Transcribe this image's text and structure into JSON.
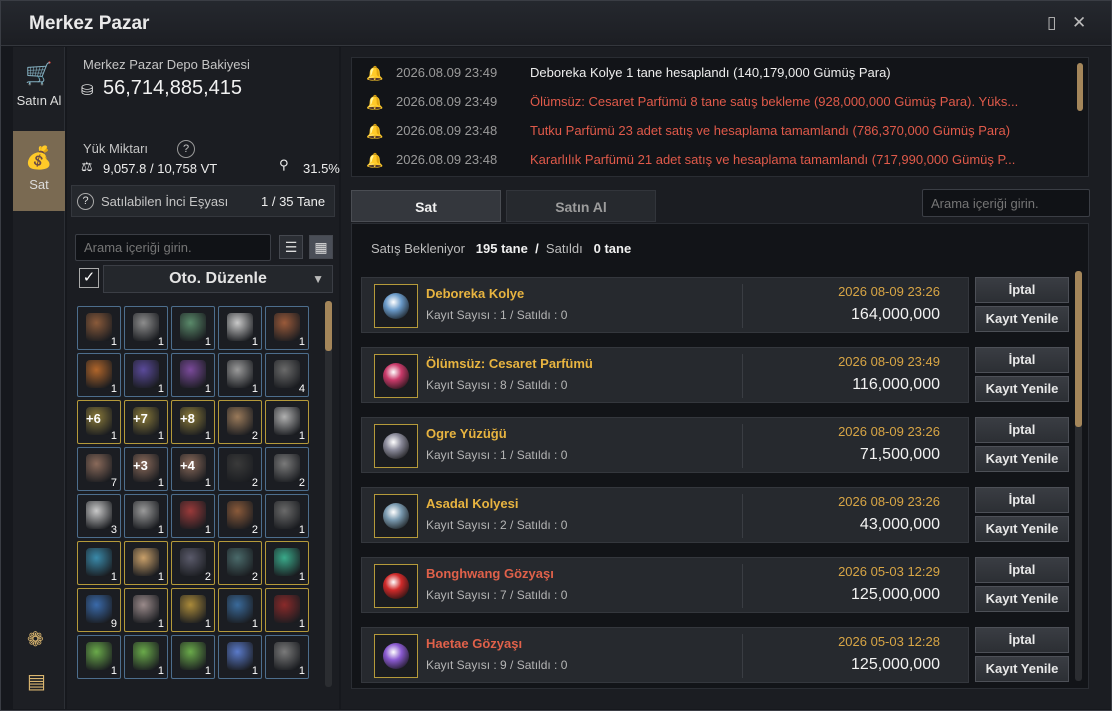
{
  "window": {
    "title": "Merkez Pazar"
  },
  "nav": {
    "buy_label": "Satın Al",
    "sell_label": "Sat"
  },
  "wallet": {
    "label": "Merkez Pazar Depo Bakiyesi",
    "value": "56,714,885,415"
  },
  "weight": {
    "label": "Yük Miktarı",
    "value": "9,057.8 / 10,758 VT",
    "percent": "31.5%"
  },
  "pearl": {
    "label": "Satılabilen İnci Eşyası",
    "value": "1 / 35 Tane"
  },
  "left_search": {
    "placeholder": "Arama içeriği girin."
  },
  "auto_sort": {
    "label": "Oto. Düzenle"
  },
  "inventory": [
    {
      "color": "#8a5a3a",
      "count": "1",
      "enh": ""
    },
    {
      "color": "#8d8d8d",
      "count": "1",
      "enh": ""
    },
    {
      "color": "#5a8a6a",
      "count": "1",
      "enh": ""
    },
    {
      "color": "#c9c9c9",
      "count": "1",
      "enh": ""
    },
    {
      "color": "#9a5a3a",
      "count": "1",
      "enh": ""
    },
    {
      "color": "#b0652a",
      "count": "1",
      "enh": ""
    },
    {
      "color": "#5a4a9a",
      "count": "1",
      "enh": ""
    },
    {
      "color": "#7a4a9a",
      "count": "1",
      "enh": ""
    },
    {
      "color": "#9a9a9a",
      "count": "1",
      "enh": ""
    },
    {
      "color": "#6a6a6a",
      "count": "4",
      "enh": ""
    },
    {
      "color": "#8a7a3a",
      "count": "1",
      "enh": "+6"
    },
    {
      "color": "#8a7a3a",
      "count": "1",
      "enh": "+7"
    },
    {
      "color": "#8a7a3a",
      "count": "1",
      "enh": "+8"
    },
    {
      "color": "#9a7a5a",
      "count": "2",
      "enh": ""
    },
    {
      "color": "#b0b0b0",
      "count": "1",
      "enh": ""
    },
    {
      "color": "#8a6a5a",
      "count": "7",
      "enh": ""
    },
    {
      "color": "#8a6a5a",
      "count": "1",
      "enh": "+3"
    },
    {
      "color": "#8a6a5a",
      "count": "1",
      "enh": "+4"
    },
    {
      "color": "#3a3a3a",
      "count": "2",
      "enh": ""
    },
    {
      "color": "#7a7a7a",
      "count": "2",
      "enh": ""
    },
    {
      "color": "#c9c9c9",
      "count": "3",
      "enh": ""
    },
    {
      "color": "#9a9a9a",
      "count": "1",
      "enh": ""
    },
    {
      "color": "#9a3a3a",
      "count": "1",
      "enh": ""
    },
    {
      "color": "#8a5a3a",
      "count": "2",
      "enh": ""
    },
    {
      "color": "#6a6a6a",
      "count": "1",
      "enh": ""
    },
    {
      "color": "#3a8aaa",
      "count": "1",
      "enh": ""
    },
    {
      "color": "#c9a06a",
      "count": "1",
      "enh": ""
    },
    {
      "color": "#5a5a6a",
      "count": "2",
      "enh": ""
    },
    {
      "color": "#4a6a6a",
      "count": "2",
      "enh": ""
    },
    {
      "color": "#3aaa8a",
      "count": "1",
      "enh": ""
    },
    {
      "color": "#3a6aaa",
      "count": "9",
      "enh": ""
    },
    {
      "color": "#9a8a8a",
      "count": "1",
      "enh": ""
    },
    {
      "color": "#aa8a3a",
      "count": "1",
      "enh": ""
    },
    {
      "color": "#3a6a9a",
      "count": "1",
      "enh": ""
    },
    {
      "color": "#8a2a2a",
      "count": "1",
      "enh": ""
    },
    {
      "color": "#6aaa4a",
      "count": "1",
      "enh": ""
    },
    {
      "color": "#6aaa4a",
      "count": "1",
      "enh": ""
    },
    {
      "color": "#6aaa4a",
      "count": "1",
      "enh": ""
    },
    {
      "color": "#5a7ac9",
      "count": "1",
      "enh": ""
    },
    {
      "color": "#7a7a7a",
      "count": "1",
      "enh": ""
    }
  ],
  "log": [
    {
      "time": "2026.08.09 23:49",
      "text": "Deboreka Kolye 1 tane hesaplandı (140,179,000 Gümüş Para)",
      "color": "#eeeeee"
    },
    {
      "time": "2026.08.09 23:49",
      "text": "Ölümsüz: Cesaret Parfümü 8 tane satış bekleme (928,000,000 Gümüş Para). Yüks...",
      "color": "#e05a4a"
    },
    {
      "time": "2026.08.09 23:48",
      "text": "Tutku Parfümü 23 adet satış ve hesaplama tamamlandı (786,370,000 Gümüş Para)",
      "color": "#e05a4a"
    },
    {
      "time": "2026.08.09 23:48",
      "text": "Kararlılık Parfümü 21 adet satış ve hesaplama tamamlandı (717,990,000 Gümüş P...",
      "color": "#e05a4a"
    }
  ],
  "tabs": {
    "sell": "Sat",
    "buy": "Satın Al"
  },
  "right_search": {
    "placeholder": "Arama içeriği girin."
  },
  "status": {
    "waiting_label": "Satış Bekleniyor",
    "waiting_value": "195 tane",
    "sep": "/",
    "sold_label": "Satıldı",
    "sold_value": "0 tane"
  },
  "listings": [
    {
      "name": "Deboreka Kolye",
      "name_color": "#e8b440",
      "sub": "Kayıt Sayısı : 1 / Satıldı : 0",
      "date": "2026 08-09 23:26",
      "price": "164,000,000",
      "icon": "#6a9ac9"
    },
    {
      "name": "Ölümsüz: Cesaret Parfümü",
      "name_color": "#e8b440",
      "sub": "Kayıt Sayısı : 8 / Satıldı : 0",
      "date": "2026 08-09 23:49",
      "price": "116,000,000",
      "icon": "#c93a6a"
    },
    {
      "name": "Ogre Yüzüğü",
      "name_color": "#e8b440",
      "sub": "Kayıt Sayısı : 1 / Satıldı : 0",
      "date": "2026 08-09 23:26",
      "price": "71,500,000",
      "icon": "#8a8a9a"
    },
    {
      "name": "Asadal Kolyesi",
      "name_color": "#e8b440",
      "sub": "Kayıt Sayısı : 2 / Satıldı : 0",
      "date": "2026 08-09 23:26",
      "price": "43,000,000",
      "icon": "#7a9ab0"
    },
    {
      "name": "Bonghwang Gözyaşı",
      "name_color": "#e0614a",
      "sub": "Kayıt Sayısı : 7 / Satıldı : 0",
      "date": "2026 05-03 12:29",
      "price": "125,000,000",
      "icon": "#d02a2a"
    },
    {
      "name": "Haetae Gözyaşı",
      "name_color": "#e0614a",
      "sub": "Kayıt Sayısı : 9 / Satıldı : 0",
      "date": "2026 05-03 12:28",
      "price": "125,000,000",
      "icon": "#8a5ad0"
    }
  ],
  "buttons": {
    "cancel": "İptal",
    "renew": "Kayıt Yenile"
  }
}
